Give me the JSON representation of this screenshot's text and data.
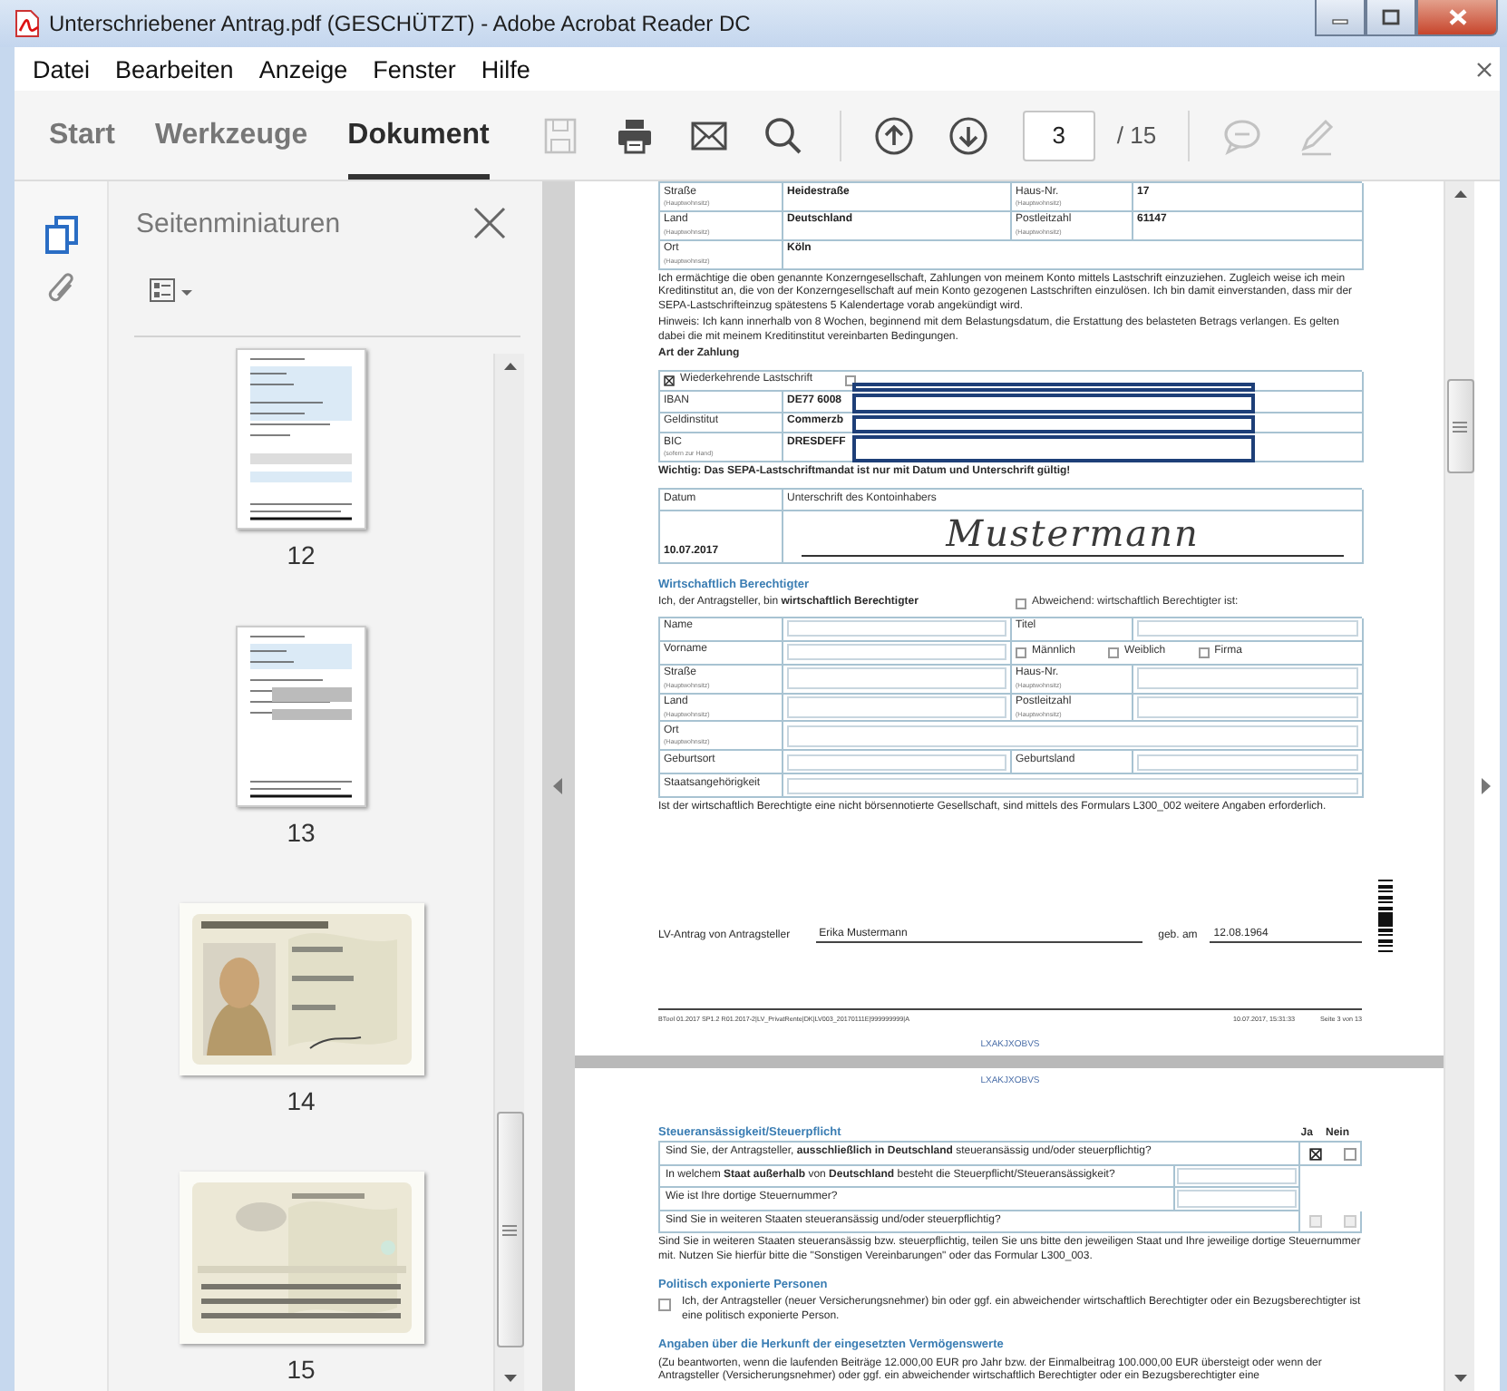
{
  "window": {
    "title": "Unterschriebener Antrag.pdf (GESCHÜTZT) - Adobe Acrobat Reader DC"
  },
  "menu": [
    "Datei",
    "Bearbeiten",
    "Anzeige",
    "Fenster",
    "Hilfe"
  ],
  "tabs": [
    {
      "label": "Start",
      "selected": false
    },
    {
      "label": "Werkzeuge",
      "selected": false
    },
    {
      "label": "Dokument",
      "selected": true
    }
  ],
  "tool_groups": [
    [
      {
        "kind": "save",
        "disabled": true
      },
      {
        "kind": "print",
        "disabled": false
      },
      {
        "kind": "mail",
        "disabled": false
      },
      {
        "kind": "search",
        "disabled": false
      }
    ],
    [
      {
        "kind": "page-up",
        "disabled": false
      },
      {
        "kind": "page-down",
        "disabled": false
      },
      {
        "kind": "page-field",
        "value": "3",
        "disabled": false
      },
      {
        "kind": "page-total",
        "text": "/ 15",
        "disabled": false
      }
    ],
    [
      {
        "kind": "comment",
        "disabled": true
      },
      {
        "kind": "sign",
        "disabled": true
      }
    ]
  ],
  "nav_rail": [
    {
      "kind": "pages",
      "selected": true
    },
    {
      "kind": "attachments",
      "selected": false
    }
  ],
  "sidebar": {
    "title": "Seitenminiaturen",
    "thumbnails": [
      {
        "kind": "page",
        "label": "12"
      },
      {
        "kind": "page",
        "label": "13"
      },
      {
        "kind": "picture",
        "label": "14"
      },
      {
        "kind": "picture",
        "label": "15"
      }
    ]
  },
  "document": {
    "pages": [
      {
        "blocks": [
          {
            "kind": "table",
            "rows": [
              {
                "cells": [
                  {
                    "kind": "label",
                    "text": "Straße",
                    "note": "(Hauptwohnsitz)"
                  },
                  {
                    "kind": "value",
                    "text": "Heidestraße"
                  },
                  {
                    "kind": "label",
                    "text": "Haus-Nr.",
                    "note": "(Hauptwohnsitz)"
                  },
                  {
                    "kind": "value",
                    "text": "17"
                  }
                ]
              },
              {
                "cells": [
                  {
                    "kind": "label",
                    "text": "Land",
                    "note": "(Hauptwohnsitz)"
                  },
                  {
                    "kind": "value",
                    "text": "Deutschland"
                  },
                  {
                    "kind": "label",
                    "text": "Postleitzahl",
                    "note": "(Hauptwohnsitz)"
                  },
                  {
                    "kind": "value",
                    "text": "61147"
                  }
                ]
              },
              {
                "cells": [
                  {
                    "kind": "label",
                    "text": "Ort",
                    "note": "(Hauptwohnsitz)"
                  },
                  {
                    "kind": "value",
                    "text": "Köln",
                    "wide": true
                  }
                ]
              }
            ]
          },
          {
            "kind": "paragraph",
            "text": "Ich ermächtige die oben genannte Konzerngesellschaft, Zahlungen von meinem Konto mittels Lastschrift einzuziehen. Zugleich weise ich mein Kreditinstitut an, die von der Konzerngesellschaft auf mein Konto gezogenen Lastschriften einzulösen. Ich bin damit einverstanden, dass mir der SEPA-Lastschrifteinzug spätestens 5 Kalendertage vorab angekündigt wird."
          },
          {
            "kind": "paragraph",
            "text": "Hinweis: Ich kann innerhalb von 8 Wochen, beginnend mit dem Belastungsdatum, die Erstattung des belasteten Betrags verlangen. Es gelten dabei die mit meinem Kreditinstitut vereinbarten Bedingungen."
          },
          {
            "kind": "subheading",
            "text": "Art der Zahlung"
          },
          {
            "kind": "table",
            "rows": [
              {
                "redacted": true,
                "cells": [
                  {
                    "kind": "options",
                    "wide": true,
                    "options": [
                      {
                        "label": "Wiederkehrende Lastschrift",
                        "checked": true
                      },
                      {
                        "checked": false
                      }
                    ]
                  }
                ]
              },
              {
                "redacted": true,
                "cells": [
                  {
                    "kind": "label",
                    "text": "IBAN"
                  },
                  {
                    "kind": "value",
                    "text": "DE77 6008",
                    "wide": true
                  }
                ]
              },
              {
                "redacted": true,
                "cells": [
                  {
                    "kind": "label",
                    "text": "Geldinstitut"
                  },
                  {
                    "kind": "value",
                    "text": "Commerzb",
                    "wide": true
                  }
                ]
              },
              {
                "redacted": true,
                "cells": [
                  {
                    "kind": "label",
                    "text": "BIC",
                    "note": "(sofern zur Hand)"
                  },
                  {
                    "kind": "value",
                    "text": "DRESDEFF",
                    "wide": true
                  }
                ]
              }
            ]
          },
          {
            "kind": "subheading",
            "text": "Wichtig: Das SEPA-Lastschriftmandat ist nur mit Datum und Unterschrift gültig!"
          },
          {
            "kind": "signature",
            "date_label": "Datum",
            "sign_label": "Unterschrift des Kontoinhabers",
            "date": "10.07.2017",
            "signature": "Mustermann"
          },
          {
            "kind": "heading",
            "text": "Wirtschaftlich Berechtigter"
          },
          {
            "kind": "choice_line",
            "text": "Ich, der Antragsteller, bin **wirtschaftlich Berechtigter**",
            "option": {
              "label": "Abweichend: wirtschaftlich Berechtigter ist:",
              "checked": false
            }
          },
          {
            "kind": "table",
            "rows": [
              {
                "cells": [
                  {
                    "kind": "label",
                    "text": "Name"
                  },
                  {
                    "kind": "input"
                  },
                  {
                    "kind": "label",
                    "text": "Titel"
                  },
                  {
                    "kind": "input"
                  }
                ]
              },
              {
                "cells": [
                  {
                    "kind": "label",
                    "text": "Vorname"
                  },
                  {
                    "kind": "input"
                  },
                  {
                    "kind": "options",
                    "wide": true,
                    "options": [
                      {
                        "label": "Männlich",
                        "checked": false
                      },
                      {
                        "label": "Weiblich",
                        "checked": false
                      },
                      {
                        "label": "Firma",
                        "checked": false
                      }
                    ]
                  }
                ]
              },
              {
                "cells": [
                  {
                    "kind": "label",
                    "text": "Straße",
                    "note": "(Hauptwohnsitz)"
                  },
                  {
                    "kind": "input"
                  },
                  {
                    "kind": "label",
                    "text": "Haus-Nr.",
                    "note": "(Hauptwohnsitz)"
                  },
                  {
                    "kind": "input"
                  }
                ]
              },
              {
                "cells": [
                  {
                    "kind": "label",
                    "text": "Land",
                    "note": "(Hauptwohnsitz)"
                  },
                  {
                    "kind": "input"
                  },
                  {
                    "kind": "label",
                    "text": "Postleitzahl",
                    "note": "(Hauptwohnsitz)"
                  },
                  {
                    "kind": "input"
                  }
                ]
              },
              {
                "cells": [
                  {
                    "kind": "label",
                    "text": "Ort",
                    "note": "(Hauptwohnsitz)"
                  },
                  {
                    "kind": "input",
                    "wide": true
                  }
                ]
              },
              {
                "cells": [
                  {
                    "kind": "label",
                    "text": "Geburtsort"
                  },
                  {
                    "kind": "input"
                  },
                  {
                    "kind": "label",
                    "text": "Geburtsland"
                  },
                  {
                    "kind": "input"
                  }
                ]
              },
              {
                "cells": [
                  {
                    "kind": "label",
                    "text": "Staatsangehörigkeit"
                  },
                  {
                    "kind": "input",
                    "wide": true
                  }
                ]
              }
            ]
          },
          {
            "kind": "paragraph",
            "text": "Ist der wirtschaftlich Berechtigte eine nicht börsennotierte Gesellschaft, sind mittels des Formulars L300_002 weitere Angaben erforderlich."
          },
          {
            "kind": "applicant",
            "label": "LV-Antrag von Antragsteller",
            "name": "Erika Mustermann",
            "born_label": "geb. am",
            "born": "12.08.1964"
          },
          {
            "kind": "footer",
            "left": "BTool 01.2017 SP1.2 R01.2017-2|LV_PrivatRente|DK|LV003_20170111E|999999999|A",
            "date": "10.07.2017, 15:31:33",
            "page": "Seite 3 von 13"
          },
          {
            "kind": "code",
            "text": "LXAKJXOBVS"
          }
        ]
      },
      {
        "blocks": [
          {
            "kind": "code",
            "text": "LXAKJXOBVS"
          },
          {
            "kind": "question_table",
            "title": "Steueransässigkeit/Steuerpflicht",
            "answer_labels": [
              "Ja",
              "Nein"
            ],
            "rows": [
              {
                "kind": "yesno",
                "text": "Sind Sie, der Antragsteller, **ausschließlich in Deutschland** steueransässig und/oder steuerpflichtig?",
                "answers": [
                  {
                    "checked": true,
                    "disabled": false
                  },
                  {
                    "checked": false,
                    "disabled": false
                  }
                ]
              },
              {
                "kind": "input",
                "text": "In welchem **Staat außerhalb** von **Deutschland** besteht die Steuerpflicht/Steueransässigkeit?"
              },
              {
                "kind": "input",
                "text": "Wie ist Ihre dortige Steuernummer?"
              },
              {
                "kind": "yesno",
                "text": "Sind Sie in weiteren Staaten steueransässig und/oder steuerpflichtig?",
                "answers": [
                  {
                    "checked": false,
                    "disabled": true
                  },
                  {
                    "checked": false,
                    "disabled": true
                  }
                ]
              }
            ]
          },
          {
            "kind": "paragraph",
            "text": "Sind Sie in weiteren Staaten steueransässig bzw. steuerpflichtig, teilen Sie uns bitte den jeweiligen Staat und Ihre jeweilige dortige Steuernummer mit. Nutzen Sie hierfür bitte die \"Sonstigen Vereinbarungen\" oder das Formular L300_003."
          },
          {
            "kind": "heading",
            "text": "Politisch exponierte Personen"
          },
          {
            "kind": "check_paragraph",
            "checked": false,
            "text": "Ich, der Antragsteller (neuer Versicherungsnehmer) bin oder ggf. ein abweichender wirtschaftlich Berechtigter oder ein Bezugsberechtigter ist eine politisch exponierte Person."
          },
          {
            "kind": "heading",
            "text": "Angaben über die Herkunft der eingesetzten Vermögenswerte"
          },
          {
            "kind": "paragraph",
            "text": "(Zu beantworten, wenn die laufenden Beiträge 12.000,00 EUR pro Jahr bzw. der Einmalbeitrag 100.000,00 EUR übersteigt oder wenn der Antragsteller (Versicherungsnehmer) oder ggf. ein abweichender wirtschaftlich Berechtigter oder ein Bezugsberechtigter eine"
          }
        ]
      }
    ]
  }
}
